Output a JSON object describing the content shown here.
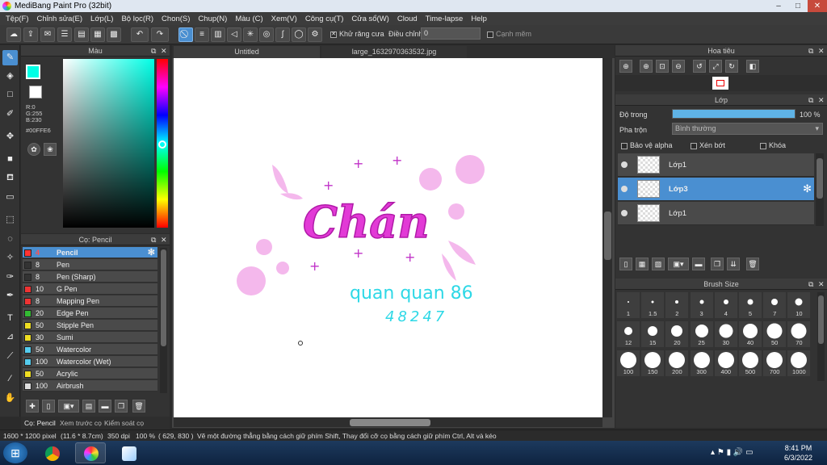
{
  "window": {
    "title": "MediBang Paint Pro (32bit)",
    "minimize": "–",
    "maximize": "□",
    "close": "✕"
  },
  "menu": [
    "Tệp(F)",
    "Chỉnh sửa(E)",
    "Lớp(L)",
    "Bộ lọc(R)",
    "Chon(S)",
    "Chup(N)",
    "Màu (C)",
    "Xem(V)",
    "Công cụ(T)",
    "Cửa sổ(W)",
    "Cloud",
    "Time-lapse",
    "Help"
  ],
  "toolbar": {
    "antialias_label": "Khử răng cưa",
    "antialias_checked": "✕",
    "correction_label": "Điều chỉnh",
    "correction_value": "0",
    "sharp_label": "Cạnh mẽm"
  },
  "color_panel": {
    "title": "Màu",
    "fg_color": "#00FFE6",
    "r": "R:0",
    "g": "G:255",
    "b": "B:230",
    "hex": "#00FFE6"
  },
  "brush_panel": {
    "title": "Cọ: Pencil",
    "items": [
      {
        "size": "4",
        "name": "Pencil",
        "color": "#ff3333",
        "selected": true
      },
      {
        "size": "8",
        "name": "Pen",
        "color": "#333333"
      },
      {
        "size": "8",
        "name": "Pen (Sharp)",
        "color": "#333333"
      },
      {
        "size": "10",
        "name": "G Pen",
        "color": "#ee3333"
      },
      {
        "size": "8",
        "name": "Mapping Pen",
        "color": "#ee3333"
      },
      {
        "size": "20",
        "name": "Edge Pen",
        "color": "#33bb33"
      },
      {
        "size": "50",
        "name": "Stipple Pen",
        "color": "#eedd22"
      },
      {
        "size": "30",
        "name": "Sumi",
        "color": "#eedd22"
      },
      {
        "size": "50",
        "name": "Watercolor",
        "color": "#55ccee"
      },
      {
        "size": "100",
        "name": "Watercolor (Wet)",
        "color": "#55ccee"
      },
      {
        "size": "50",
        "name": "Acrylic",
        "color": "#eedd22"
      },
      {
        "size": "100",
        "name": "Airbrush",
        "color": "#dddddd"
      }
    ]
  },
  "left_tabs": [
    "Cọ: Pencil",
    "Xem trước cọ",
    "Kiểm soát cọ"
  ],
  "doc_tabs": [
    "Untitled",
    "large_1632970363532.jpg"
  ],
  "canvas": {
    "title_text": "Chán",
    "sign_line1": "quan quan 86",
    "sign_line2": "48247"
  },
  "navigator": {
    "title": "Hoa tiêu"
  },
  "layer_panel": {
    "title": "Lớp",
    "opacity_label": "Độ trong",
    "opacity_value": "100 %",
    "opacity_fraction": 1.0,
    "blend_label": "Pha trộn",
    "blend_value": "Bình thường",
    "protect_alpha": "Bảo vệ alpha",
    "clipping": "Xén bớt",
    "lock": "Khóa",
    "layers": [
      {
        "name": "Lớp1",
        "selected": false
      },
      {
        "name": "Lớp3",
        "selected": true
      },
      {
        "name": "Lớp1",
        "selected": false
      }
    ]
  },
  "brush_size": {
    "title": "Brush Size",
    "sizes": [
      "1",
      "1.5",
      "2",
      "3",
      "4",
      "5",
      "7",
      "10",
      "12",
      "15",
      "20",
      "25",
      "30",
      "40",
      "50",
      "70",
      "100",
      "150",
      "200",
      "300",
      "400",
      "500",
      "700",
      "1000"
    ]
  },
  "status": {
    "size": "1600 * 1200 pixel",
    "physical": "(11.6 * 8.7cm)",
    "dpi": "350 dpi",
    "zoom": "100 %",
    "coords": "( 629, 830 )",
    "hint": "Vẽ một đường thẳng bằng cách giữ phím Shift, Thay đổi cỡ cọ bằng cách giữ phím Ctrl, Alt và kéo"
  },
  "taskbar": {
    "time": "8:41 PM",
    "date": "6/3/2022"
  }
}
